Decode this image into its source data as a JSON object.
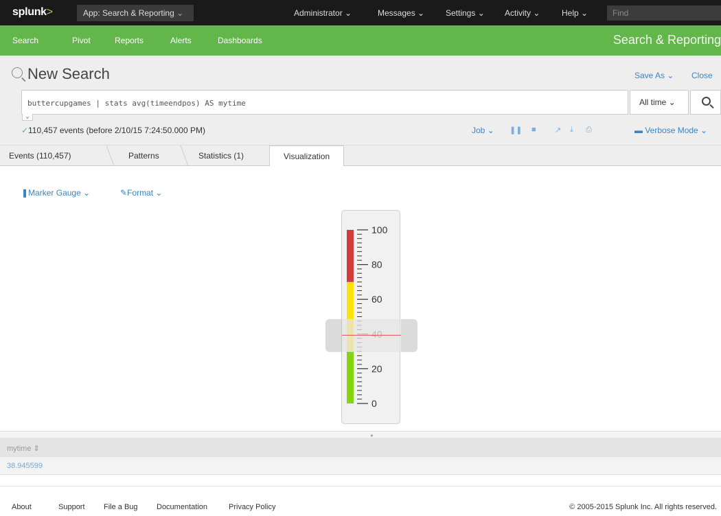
{
  "topbar": {
    "logo": "splunk",
    "logo_suffix": ">",
    "app_menu": "App: Search & Reporting",
    "nav": [
      "Administrator",
      "Messages",
      "Settings",
      "Activity",
      "Help"
    ],
    "find_placeholder": "Find"
  },
  "appbar": {
    "tabs": [
      "Search",
      "Pivot",
      "Reports",
      "Alerts",
      "Dashboards"
    ],
    "app_title": "Search & Reporting"
  },
  "search": {
    "title": "New Search",
    "save_as": "Save As",
    "close": "Close",
    "query": "buttercupgames | stats avg(timeendpos) AS mytime",
    "time_range": "All time",
    "status": "110,457 events (before 2/10/15 7:24:50.000 PM)",
    "job": "Job",
    "mode": "Verbose Mode"
  },
  "tabs": [
    "Events (110,457)",
    "Patterns",
    "Statistics (1)",
    "Visualization"
  ],
  "viz": {
    "type_label": "Marker Gauge",
    "format_label": "Format",
    "gauge_min": 0,
    "gauge_max": 100,
    "gauge_value": 38.945599,
    "ticks": [
      "100",
      "80",
      "60",
      "40",
      "20",
      "0"
    ],
    "ranges": [
      {
        "from": 0,
        "to": 30,
        "color": "#84d40f"
      },
      {
        "from": 30,
        "to": 70,
        "color": "#fbe20a"
      },
      {
        "from": 70,
        "to": 100,
        "color": "#d23c3c"
      }
    ],
    "marker_color": "#e35a5a"
  },
  "table": {
    "column": "mytime",
    "sort_indicator": "⇕",
    "value": "38.945599"
  },
  "footer": {
    "links": [
      "About",
      "Support",
      "File a Bug",
      "Documentation",
      "Privacy Policy"
    ],
    "copyright": "© 2005-2015 Splunk Inc. All rights reserved."
  }
}
